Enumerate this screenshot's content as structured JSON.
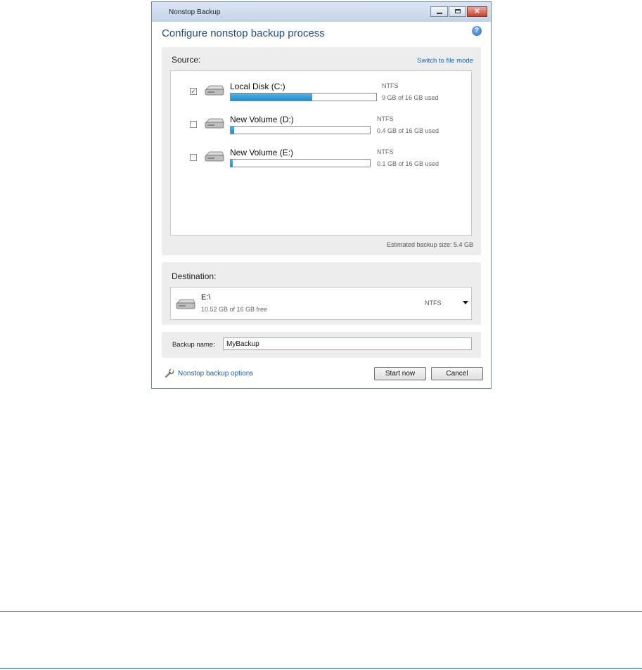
{
  "window": {
    "title": "Nonstop Backup"
  },
  "heading": "Configure nonstop backup process",
  "source": {
    "label": "Source:",
    "switch_link": "Switch to file mode",
    "disks": [
      {
        "name": "Local Disk (C:)",
        "fs": "NTFS",
        "used_text": "9 GB of 16 GB used",
        "used_fraction": 0.5625,
        "checked": true
      },
      {
        "name": "New Volume (D:)",
        "fs": "NTFS",
        "used_text": "0.4 GB of 16 GB used",
        "used_fraction": 0.025,
        "checked": false
      },
      {
        "name": "New Volume (E:)",
        "fs": "NTFS",
        "used_text": "0.1 GB of 16 GB used",
        "used_fraction": 0.006,
        "checked": false
      }
    ],
    "estimated": "Estimated backup size: 5.4 GB"
  },
  "destination": {
    "label": "Destination:",
    "name": "E:\\",
    "free": "10.52 GB of 16 GB free",
    "fs": "NTFS"
  },
  "backup_name": {
    "label": "Backup name:",
    "value": "MyBackup"
  },
  "footer": {
    "options_link": "Nonstop backup options",
    "start_label": "Start now",
    "cancel_label": "Cancel"
  },
  "icons": {
    "help": "help-icon",
    "drive": "drive-icon",
    "wrench": "wrench-icon"
  },
  "colors": {
    "accent": "#1a4f92",
    "link": "#1a60b8",
    "bar_fill": "#1f8acb"
  }
}
